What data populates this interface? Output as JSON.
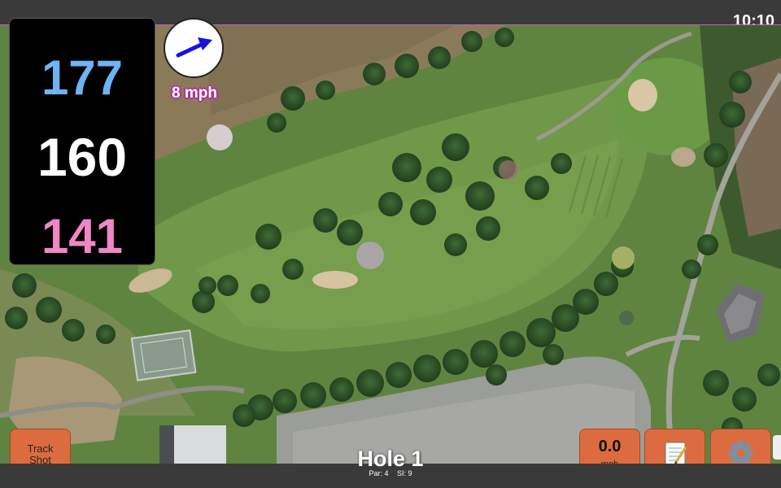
{
  "status": {
    "time": "10:10"
  },
  "distances": {
    "back": "177",
    "middle": "160",
    "front": "141"
  },
  "wind": {
    "speed_label": "8 mph",
    "arrow_color": "#1414e0",
    "direction": "east-northeast"
  },
  "buttons": {
    "track_shot_line1": "Track",
    "track_shot_line2": "Shot",
    "speed_value": "0.0",
    "speed_unit": "mph",
    "notes_icon": "notepad-icon",
    "settings_icon": "gear-icon"
  },
  "hole": {
    "title": "Hole 1",
    "par": "Par: 4",
    "si": "SI: 9"
  },
  "colors": {
    "accent": "#dc6c3f",
    "back_color": "#6fb3f5",
    "front_color": "#ef87c5",
    "map_border": "#b46bb4"
  }
}
